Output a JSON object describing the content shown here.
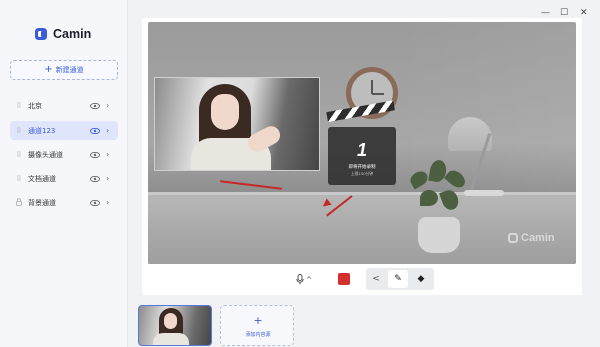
{
  "app": {
    "name": "Camin",
    "accent": "#3b5bd9"
  },
  "sidebar": {
    "new_channel_label": "新建通道",
    "channels": [
      {
        "label": "北京",
        "active": false
      },
      {
        "label": "通道123",
        "active": true
      },
      {
        "label": "摄像头通道",
        "active": false
      },
      {
        "label": "文档通道",
        "active": false
      },
      {
        "label": "背景通道",
        "active": false
      }
    ]
  },
  "window_controls": {
    "minimize": "—",
    "maximize": "☐",
    "close": "✕"
  },
  "preview": {
    "countdown_number": "1",
    "countdown_text": "即将开始录制",
    "countdown_sub": "上限150分钟",
    "watermark": "Camin"
  },
  "toolbar": {
    "mic_chevron": "^",
    "prev": "<",
    "selected_icon": "✎",
    "diamond_icon": "◆"
  },
  "bottom": {
    "add_source_plus": "+",
    "add_source_label": "添加内容源"
  }
}
